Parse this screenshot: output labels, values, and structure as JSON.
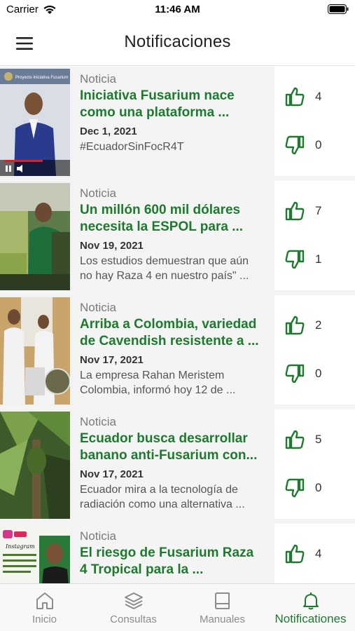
{
  "status_bar": {
    "carrier": "Carrier",
    "time": "11:46 AM"
  },
  "header": {
    "title": "Notificaciones",
    "menu_icon": "hamburger-menu-icon"
  },
  "notifications": [
    {
      "type": "Noticia",
      "title_line1": "Iniciativa Fusarium nace",
      "title_line2": "como una plataforma ...",
      "date": "Dec 1, 2021",
      "desc_line1": "#EcuadorSinFocR4T",
      "desc_line2": "",
      "likes": "4",
      "dislikes": "0",
      "thumb_overlay": "Proyecto Iniciativa Fusarium"
    },
    {
      "type": "Noticia",
      "title_line1": "Un millón 600 mil dólares",
      "title_line2": "necesita la ESPOL para ...",
      "date": "Nov 19, 2021",
      "desc_line1": "Los estudios demuestran que aún",
      "desc_line2": "no hay Raza 4 en nuestro país\" ...",
      "likes": "7",
      "dislikes": "1"
    },
    {
      "type": "Noticia",
      "title_line1": "Arriba a Colombia, variedad",
      "title_line2": "de Cavendish resistente a ...",
      "date": "Nov 17, 2021",
      "desc_line1": "La empresa Rahan Meristem",
      "desc_line2": "Colombia, informó hoy 12 de ...",
      "likes": "2",
      "dislikes": "0"
    },
    {
      "type": "Noticia",
      "title_line1": "Ecuador busca desarrollar",
      "title_line2": "banano anti-Fusarium con...",
      "date": "Nov 17, 2021",
      "desc_line1": "Ecuador mira a la tecnología de",
      "desc_line2": "radiación como una alternativa ...",
      "likes": "5",
      "dislikes": "0"
    },
    {
      "type": "Noticia",
      "title_line1": "El riesgo de Fusarium Raza",
      "title_line2": "4 Tropical para la ...",
      "date": "",
      "desc_line1": "",
      "desc_line2": "",
      "likes": "4",
      "dislikes": "",
      "thumb_overlay": "Instagram"
    }
  ],
  "tabs": [
    {
      "label": "Inicio",
      "icon": "home-icon",
      "active": false
    },
    {
      "label": "Consultas",
      "icon": "layers-icon",
      "active": false
    },
    {
      "label": "Manuales",
      "icon": "book-icon",
      "active": false
    },
    {
      "label": "Notificationes",
      "icon": "bell-icon",
      "active": true
    }
  ],
  "colors": {
    "accent": "#1d7a2f",
    "inactive": "#8c8c8c"
  }
}
